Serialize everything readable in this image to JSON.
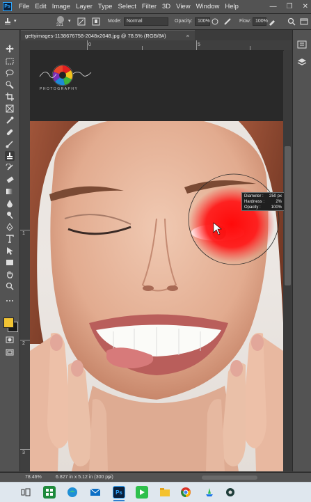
{
  "app": {
    "logo_text": "Ps"
  },
  "menu": {
    "items": [
      "File",
      "Edit",
      "Image",
      "Layer",
      "Type",
      "Select",
      "Filter",
      "3D",
      "View",
      "Window",
      "Help"
    ]
  },
  "window_controls": {
    "minimize": "—",
    "restore": "❐",
    "close": "✕"
  },
  "options": {
    "brush_size": "321",
    "mode_label": "Mode:",
    "mode_value": "Normal",
    "opacity_label": "Opacity:",
    "opacity_value": "100%",
    "flow_label": "Flow:",
    "flow_value": "100%"
  },
  "document": {
    "tab_title": "gettyimages-1138676758-2048x2048.jpg @ 78.5% (RGB/8#)",
    "close_label": "×"
  },
  "rulers": {
    "top": [
      "0",
      "5"
    ],
    "left": [
      "1",
      "2",
      "3"
    ]
  },
  "logo": {
    "tagline": "PHOTOGRAPHY"
  },
  "brush_info": {
    "diameter_label": "Diameter :",
    "diameter_value": "250 px",
    "hardness_label": "Hardness :",
    "hardness_value": "2%",
    "opacity_label": "Opacity :",
    "opacity_value": "100%"
  },
  "status": {
    "zoom": "78.46%",
    "doc_info": "6.827 in x 5.12 in (300 ppi)"
  },
  "colors": {
    "foreground": "#f2c433",
    "background": "#1a1a1a",
    "accent": "#31a8ff",
    "retouch_red": "#ff1a1a"
  }
}
